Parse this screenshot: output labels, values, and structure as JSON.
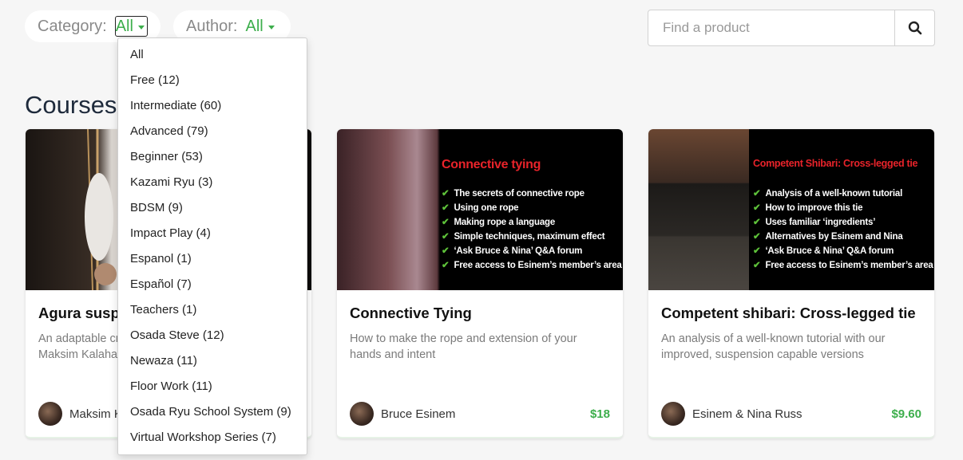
{
  "filters": {
    "category": {
      "label": "Category:",
      "value": "All"
    },
    "author": {
      "label": "Author:",
      "value": "All"
    }
  },
  "search": {
    "placeholder": "Find a product"
  },
  "section": {
    "title": "Courses"
  },
  "dropdown": {
    "items": [
      "All",
      "Free (12)",
      "Intermediate (60)",
      "Advanced (79)",
      "Beginner (53)",
      "Kazami Ryu (3)",
      "BDSM (9)",
      "Impact Play (4)",
      "Espanol (1)",
      "Español (7)",
      "Teachers (1)",
      "Osada Steve (12)",
      "Newaza (11)",
      "Floor Work (11)",
      "Osada Ryu School System (9)",
      "Virtual Workshop Series (7)"
    ]
  },
  "cards": [
    {
      "title": "Agura suspe",
      "description": "An adaptable cro\nMaksim Kalahan",
      "author": "Maksim K",
      "price": ""
    },
    {
      "title": "Connective Tying",
      "description": "How to make the rope and extension of your hands and intent",
      "author": "Bruce Esinem",
      "price": "$18",
      "promo": {
        "title": "Connective tying",
        "bullets": [
          "The secrets of connective rope",
          "Using one rope",
          "Making rope a language",
          "Simple techniques, maximum effect",
          "‘Ask Bruce & Nina’ Q&A forum",
          "Free access to Esinem’s member’s area"
        ]
      }
    },
    {
      "title": "Competent shibari: Cross-legged tie",
      "description": "An analysis of a well-known tutorial with our improved, suspension capable versions",
      "author": "Esinem & Nina Russ",
      "price": "$9.60",
      "promo": {
        "title": "Competent Shibari: Cross-legged tie",
        "bullets": [
          "Analysis of a well-known tutorial",
          "How to improve this tie",
          "Uses familiar ‘ingredients’",
          "Alternatives by Esinem and Nina",
          "‘Ask Bruce & Nina’ Q&A forum",
          "Free access to Esinem’s member’s area"
        ]
      }
    }
  ],
  "colors": {
    "accent": "#3dae4c",
    "promo_title": "#e8232a",
    "check": "#5ec23a",
    "background": "#f6f6f6"
  },
  "icons": [
    "search-icon",
    "chevron-down-icon",
    "check-icon"
  ]
}
